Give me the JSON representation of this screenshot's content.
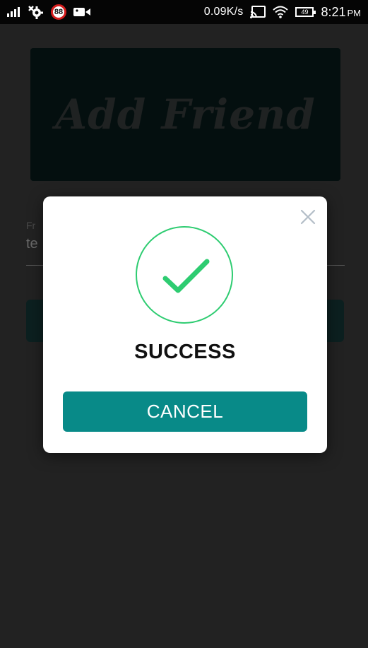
{
  "status_bar": {
    "badge_text": "88",
    "net_speed": "0.09K/s",
    "battery_level": "49",
    "time": "8:21",
    "ampm": "PM",
    "icons": [
      "signal-icon",
      "gear-bug-icon",
      "badge-88-icon",
      "video-icon",
      "cast-icon",
      "wifi-icon",
      "battery-icon"
    ]
  },
  "background": {
    "header_title": "Add Friend",
    "field_label": "Fr",
    "field_value": "te"
  },
  "modal": {
    "close_icon": "close-icon",
    "status_icon": "check-circle-icon",
    "title": "SUCCESS",
    "cancel_label": "CANCEL"
  },
  "colors": {
    "accent_teal": "#088a88",
    "success_green": "#2ecc71",
    "overlay_bg": "#222222"
  }
}
